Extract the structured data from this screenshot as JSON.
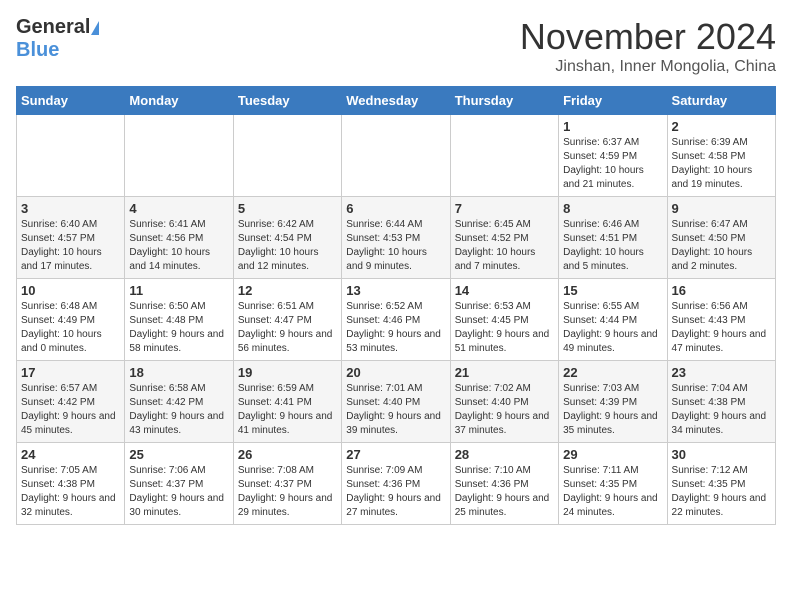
{
  "logo": {
    "line1": "General",
    "line2": "Blue"
  },
  "header": {
    "title": "November 2024",
    "location": "Jinshan, Inner Mongolia, China"
  },
  "days_of_week": [
    "Sunday",
    "Monday",
    "Tuesday",
    "Wednesday",
    "Thursday",
    "Friday",
    "Saturday"
  ],
  "weeks": [
    [
      {
        "day": "",
        "info": ""
      },
      {
        "day": "",
        "info": ""
      },
      {
        "day": "",
        "info": ""
      },
      {
        "day": "",
        "info": ""
      },
      {
        "day": "",
        "info": ""
      },
      {
        "day": "1",
        "info": "Sunrise: 6:37 AM\nSunset: 4:59 PM\nDaylight: 10 hours and 21 minutes."
      },
      {
        "day": "2",
        "info": "Sunrise: 6:39 AM\nSunset: 4:58 PM\nDaylight: 10 hours and 19 minutes."
      }
    ],
    [
      {
        "day": "3",
        "info": "Sunrise: 6:40 AM\nSunset: 4:57 PM\nDaylight: 10 hours and 17 minutes."
      },
      {
        "day": "4",
        "info": "Sunrise: 6:41 AM\nSunset: 4:56 PM\nDaylight: 10 hours and 14 minutes."
      },
      {
        "day": "5",
        "info": "Sunrise: 6:42 AM\nSunset: 4:54 PM\nDaylight: 10 hours and 12 minutes."
      },
      {
        "day": "6",
        "info": "Sunrise: 6:44 AM\nSunset: 4:53 PM\nDaylight: 10 hours and 9 minutes."
      },
      {
        "day": "7",
        "info": "Sunrise: 6:45 AM\nSunset: 4:52 PM\nDaylight: 10 hours and 7 minutes."
      },
      {
        "day": "8",
        "info": "Sunrise: 6:46 AM\nSunset: 4:51 PM\nDaylight: 10 hours and 5 minutes."
      },
      {
        "day": "9",
        "info": "Sunrise: 6:47 AM\nSunset: 4:50 PM\nDaylight: 10 hours and 2 minutes."
      }
    ],
    [
      {
        "day": "10",
        "info": "Sunrise: 6:48 AM\nSunset: 4:49 PM\nDaylight: 10 hours and 0 minutes."
      },
      {
        "day": "11",
        "info": "Sunrise: 6:50 AM\nSunset: 4:48 PM\nDaylight: 9 hours and 58 minutes."
      },
      {
        "day": "12",
        "info": "Sunrise: 6:51 AM\nSunset: 4:47 PM\nDaylight: 9 hours and 56 minutes."
      },
      {
        "day": "13",
        "info": "Sunrise: 6:52 AM\nSunset: 4:46 PM\nDaylight: 9 hours and 53 minutes."
      },
      {
        "day": "14",
        "info": "Sunrise: 6:53 AM\nSunset: 4:45 PM\nDaylight: 9 hours and 51 minutes."
      },
      {
        "day": "15",
        "info": "Sunrise: 6:55 AM\nSunset: 4:44 PM\nDaylight: 9 hours and 49 minutes."
      },
      {
        "day": "16",
        "info": "Sunrise: 6:56 AM\nSunset: 4:43 PM\nDaylight: 9 hours and 47 minutes."
      }
    ],
    [
      {
        "day": "17",
        "info": "Sunrise: 6:57 AM\nSunset: 4:42 PM\nDaylight: 9 hours and 45 minutes."
      },
      {
        "day": "18",
        "info": "Sunrise: 6:58 AM\nSunset: 4:42 PM\nDaylight: 9 hours and 43 minutes."
      },
      {
        "day": "19",
        "info": "Sunrise: 6:59 AM\nSunset: 4:41 PM\nDaylight: 9 hours and 41 minutes."
      },
      {
        "day": "20",
        "info": "Sunrise: 7:01 AM\nSunset: 4:40 PM\nDaylight: 9 hours and 39 minutes."
      },
      {
        "day": "21",
        "info": "Sunrise: 7:02 AM\nSunset: 4:40 PM\nDaylight: 9 hours and 37 minutes."
      },
      {
        "day": "22",
        "info": "Sunrise: 7:03 AM\nSunset: 4:39 PM\nDaylight: 9 hours and 35 minutes."
      },
      {
        "day": "23",
        "info": "Sunrise: 7:04 AM\nSunset: 4:38 PM\nDaylight: 9 hours and 34 minutes."
      }
    ],
    [
      {
        "day": "24",
        "info": "Sunrise: 7:05 AM\nSunset: 4:38 PM\nDaylight: 9 hours and 32 minutes."
      },
      {
        "day": "25",
        "info": "Sunrise: 7:06 AM\nSunset: 4:37 PM\nDaylight: 9 hours and 30 minutes."
      },
      {
        "day": "26",
        "info": "Sunrise: 7:08 AM\nSunset: 4:37 PM\nDaylight: 9 hours and 29 minutes."
      },
      {
        "day": "27",
        "info": "Sunrise: 7:09 AM\nSunset: 4:36 PM\nDaylight: 9 hours and 27 minutes."
      },
      {
        "day": "28",
        "info": "Sunrise: 7:10 AM\nSunset: 4:36 PM\nDaylight: 9 hours and 25 minutes."
      },
      {
        "day": "29",
        "info": "Sunrise: 7:11 AM\nSunset: 4:35 PM\nDaylight: 9 hours and 24 minutes."
      },
      {
        "day": "30",
        "info": "Sunrise: 7:12 AM\nSunset: 4:35 PM\nDaylight: 9 hours and 22 minutes."
      }
    ]
  ]
}
